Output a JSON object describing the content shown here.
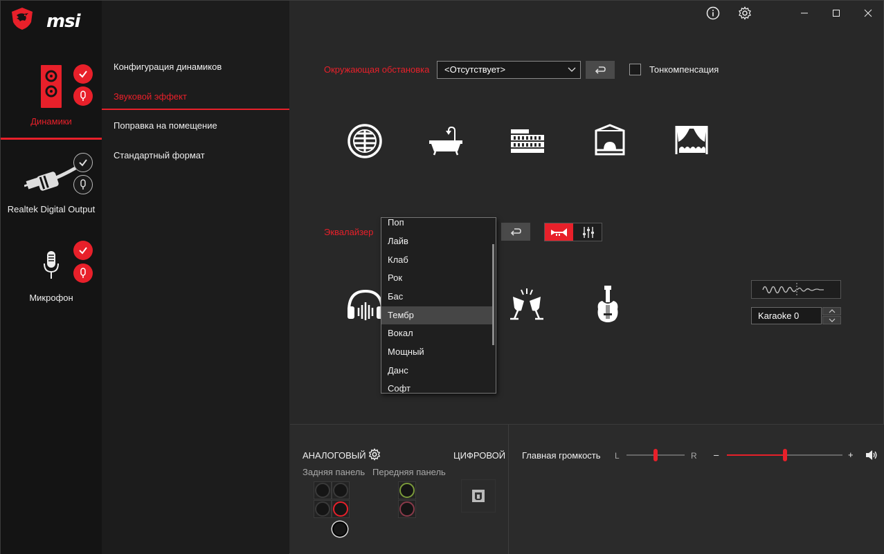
{
  "app": {
    "brand": "msi"
  },
  "titlebar": {
    "info_icon": "info-icon",
    "settings_icon": "gear-icon",
    "minimize": "minimize-icon",
    "maximize": "maximize-icon",
    "close": "close-icon"
  },
  "devices": [
    {
      "label": "Динамики",
      "active": true
    },
    {
      "label": "Realtek Digital Output",
      "active": false
    },
    {
      "label": "Микрофон",
      "active": false
    }
  ],
  "menu": {
    "items": [
      {
        "label": "Конфигурация динамиков"
      },
      {
        "label": "Звуковой эффект"
      },
      {
        "label": "Поправка на помещение"
      },
      {
        "label": "Стандартный формат"
      }
    ],
    "active_index": 1
  },
  "environment": {
    "label": "Окружающая обстановка",
    "selected": "<Отсутствует>",
    "loudness_label": "Тонкомпенсация",
    "loudness_checked": false,
    "icons": [
      "sphere-icon",
      "bathtub-icon",
      "colosseum-icon",
      "stage-icon",
      "theater-icon"
    ]
  },
  "equalizer": {
    "label": "Эквалайзер",
    "options": [
      "Поп",
      "Лайв",
      "Клаб",
      "Рок",
      "Бас",
      "Тембр",
      "Вокал",
      "Мощный",
      "Данс",
      "Софт"
    ],
    "highlighted": "Тембр",
    "icons": [
      "headphones-icon",
      "toast-glasses-icon",
      "guitar-icon"
    ]
  },
  "karaoke": {
    "value": "Karaoke 0"
  },
  "bottom": {
    "analog_label": "АНАЛОГОВЫЙ",
    "digital_label": "ЦИФРОВОЙ",
    "rear_label": "Задняя панель",
    "front_label": "Передняя панель",
    "volume_label": "Главная громкость",
    "balance_left": "L",
    "balance_right": "R",
    "minus": "–",
    "plus": "+",
    "balance_value": 0.5,
    "volume_value": 0.5
  },
  "colors": {
    "accent": "#e8202a",
    "background": "#282828",
    "sidebar": "#141414",
    "menu": "#1c1c1c"
  }
}
